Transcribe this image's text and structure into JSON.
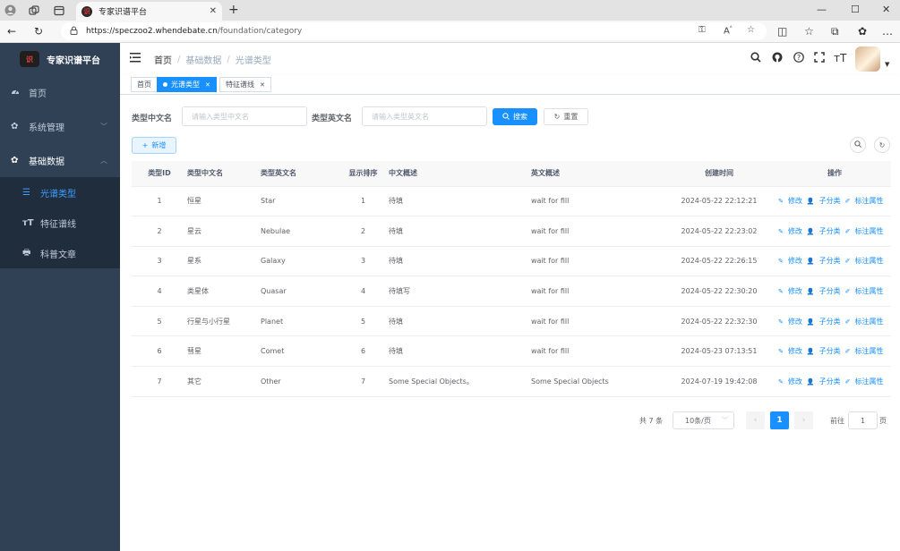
{
  "browser": {
    "tab_title": "专家识谱平台",
    "url_host": "https://speczoo2.whendebate.cn",
    "url_path": "/foundation/category"
  },
  "sidebar": {
    "brand_logo_text": "识",
    "brand_name": "专家识谱平台",
    "items": [
      {
        "label": "首页",
        "icon": "dashboard-icon"
      },
      {
        "label": "系统管理",
        "icon": "gear-icon"
      },
      {
        "label": "基础数据",
        "icon": "gear-icon"
      }
    ],
    "sub_items": [
      {
        "label": "光谱类型",
        "icon": "list-icon",
        "active": true
      },
      {
        "label": "特征谱线",
        "icon": "text-size-icon"
      },
      {
        "label": "科普文章",
        "icon": "printer-icon"
      }
    ]
  },
  "navbar": {
    "breadcrumb": [
      "首页",
      "基础数据",
      "光谱类型"
    ]
  },
  "tags": [
    {
      "label": "首页",
      "active": false
    },
    {
      "label": "光谱类型",
      "active": true
    },
    {
      "label": "特征谱线",
      "active": false
    }
  ],
  "search": {
    "cn_label": "类型中文名",
    "cn_placeholder": "请输入类型中文名",
    "en_label": "类型英文名",
    "en_placeholder": "请输入类型英文名",
    "search_button": "搜索",
    "reset_button": "重置",
    "add_button": "新增"
  },
  "table": {
    "headers": [
      "类型ID",
      "类型中文名",
      "类型英文名",
      "显示排序",
      "中文概述",
      "英文概述",
      "创建时间",
      "操作"
    ],
    "actions": [
      "修改",
      "子分类",
      "标注属性"
    ],
    "rows": [
      {
        "id": "1",
        "cn": "恒星",
        "en": "Star",
        "sort": "1",
        "cn_desc": "待填",
        "en_desc": "wait for fill",
        "time": "2024-05-22 22:12:21"
      },
      {
        "id": "2",
        "cn": "星云",
        "en": "Nebulae",
        "sort": "2",
        "cn_desc": "待填",
        "en_desc": "wait for fill",
        "time": "2024-05-22 22:23:02"
      },
      {
        "id": "3",
        "cn": "星系",
        "en": "Galaxy",
        "sort": "3",
        "cn_desc": "待填",
        "en_desc": "wait for fill",
        "time": "2024-05-22 22:26:15"
      },
      {
        "id": "4",
        "cn": "类星体",
        "en": "Quasar",
        "sort": "4",
        "cn_desc": "待填写",
        "en_desc": "wait for fill",
        "time": "2024-05-22 22:30:20"
      },
      {
        "id": "5",
        "cn": "行星与小行星",
        "en": "Planet",
        "sort": "5",
        "cn_desc": "待填",
        "en_desc": "wait for fill",
        "time": "2024-05-22 22:32:30"
      },
      {
        "id": "6",
        "cn": "彗星",
        "en": "Comet",
        "sort": "6",
        "cn_desc": "待填",
        "en_desc": "wait for fill",
        "time": "2024-05-23 07:13:51"
      },
      {
        "id": "7",
        "cn": "其它",
        "en": "Other",
        "sort": "7",
        "cn_desc": "Some Special Objects。",
        "en_desc": "Some Special Objects",
        "time": "2024-07-19 19:42:08"
      }
    ]
  },
  "pagination": {
    "total": "共 7 条",
    "page_size": "10条/页",
    "current": "1",
    "goto_label": "前往",
    "goto_value": "1",
    "page_suffix": "页"
  },
  "colors": {
    "sidebar_bg": "#304156",
    "submenu_bg": "#1f2d3d",
    "primary": "#1890ff"
  }
}
